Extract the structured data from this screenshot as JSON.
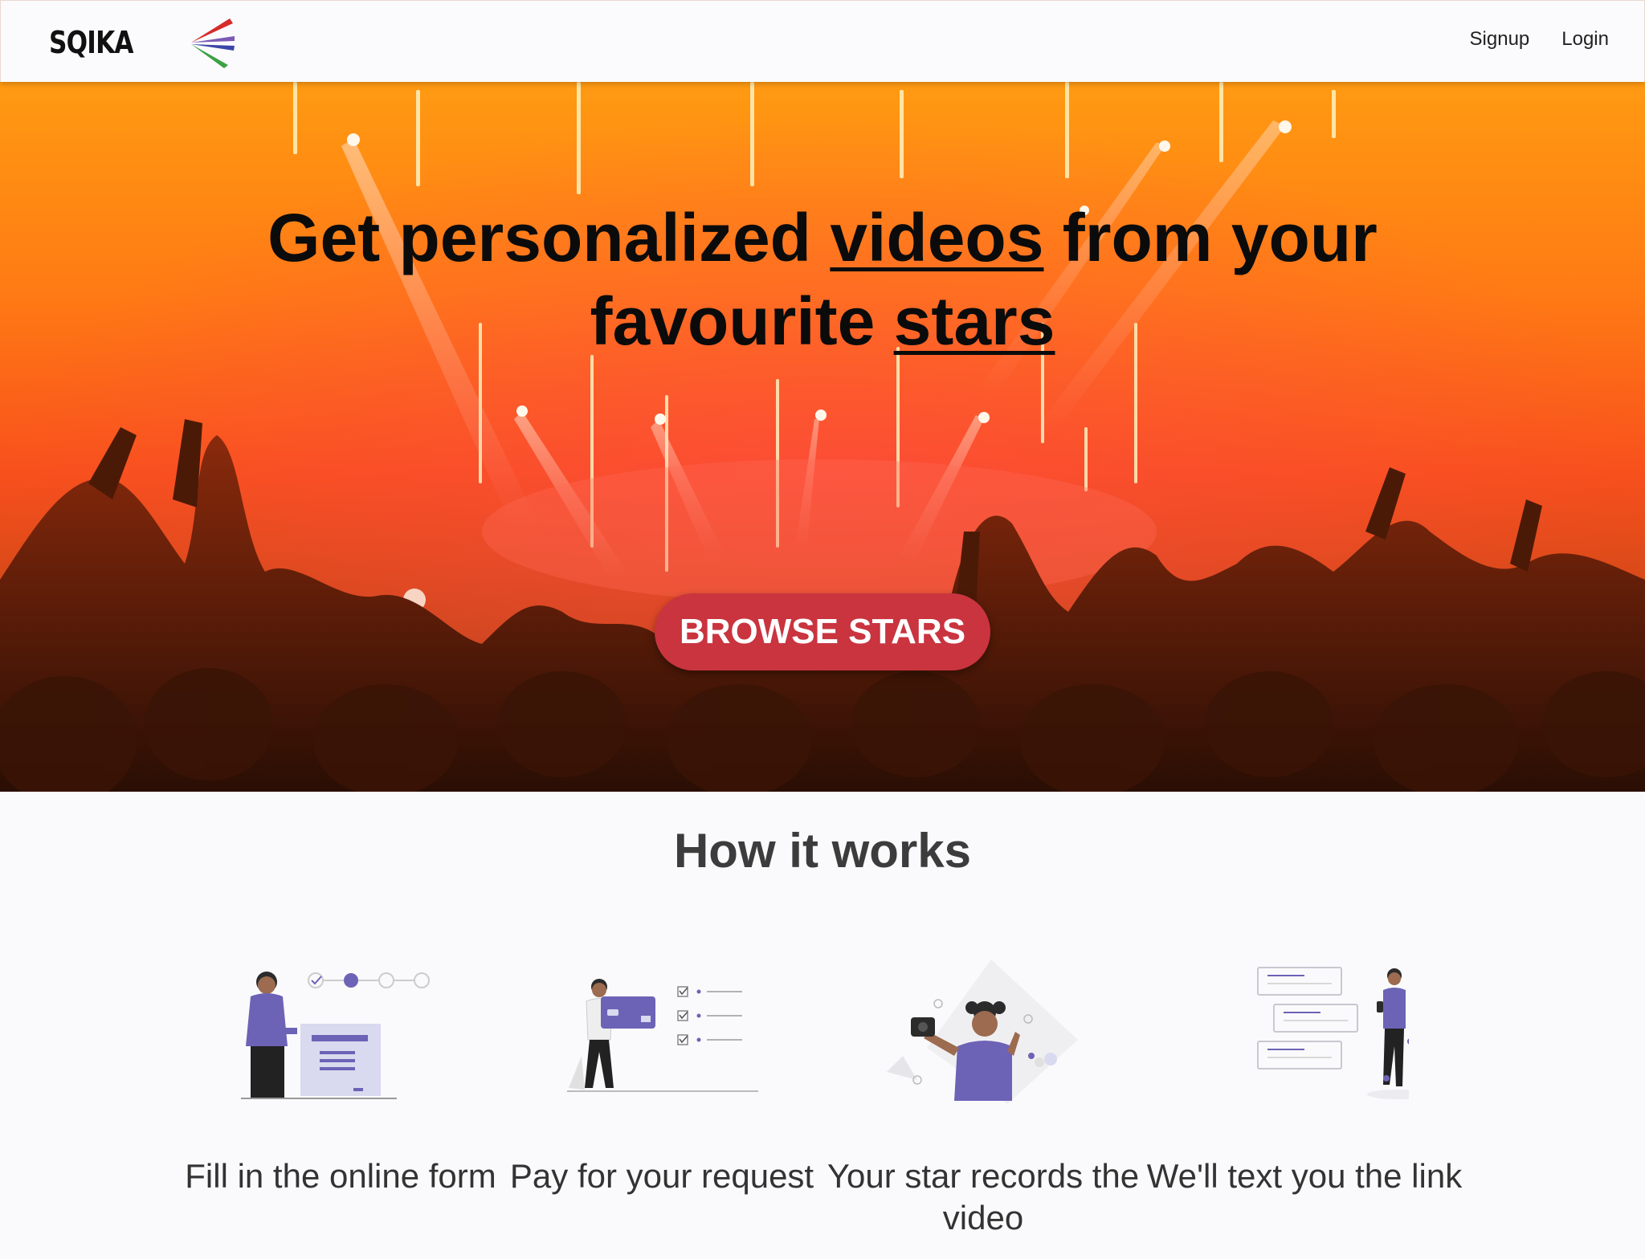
{
  "header": {
    "logo_text": "SQIKA",
    "nav": [
      {
        "label": "Signup"
      },
      {
        "label": "Login"
      }
    ]
  },
  "hero": {
    "title_part1": "Get personalized ",
    "title_link1": "videos",
    "title_part2": " from your favourite ",
    "title_link2": "stars",
    "button_label": "BROWSE STARS"
  },
  "how_it_works": {
    "title": "How it works",
    "steps": [
      {
        "label": "Fill in the online form",
        "illustration": "form-illustration"
      },
      {
        "label": "Pay for your request",
        "illustration": "payment-illustration"
      },
      {
        "label": "Your star records the video",
        "illustration": "selfie-illustration"
      },
      {
        "label": "We'll text you the link",
        "illustration": "message-illustration"
      }
    ]
  },
  "colors": {
    "accent": "#c9343f",
    "illustration_purple": "#6c63b6",
    "logo_red": "#d52b2b",
    "logo_blue": "#3b46a8",
    "logo_green": "#3ca144"
  }
}
